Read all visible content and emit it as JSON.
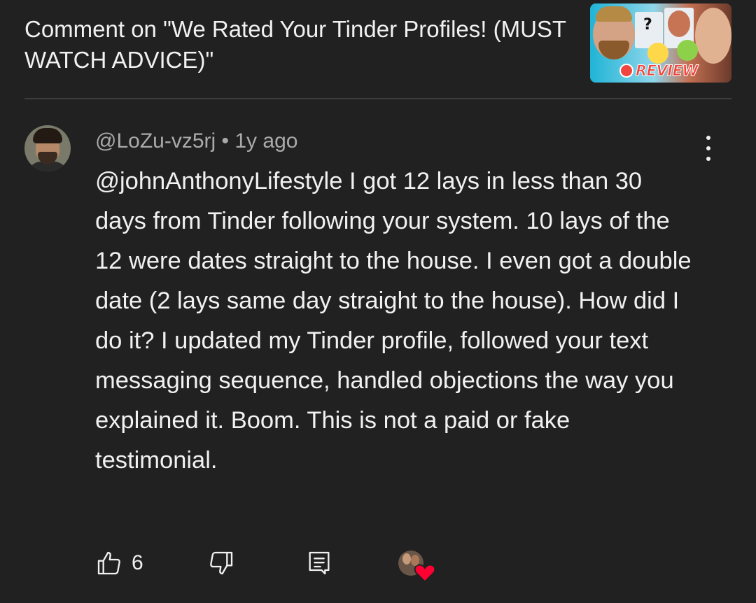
{
  "header": {
    "title": "Comment on \"We Rated Your Tinder Profiles! (MUST WATCH ADVICE)\"",
    "thumbnail_badge": "REVIEW"
  },
  "comment": {
    "author": "@LoZu-vz5rj",
    "separator": "•",
    "time": "1y ago",
    "text": "@johnAnthonyLifestyle I got 12 lays in less than 30 days from Tinder following your system. 10 lays of the 12 were dates straight to the house. I even got a double date (2 lays same day straight to the house). How did I do it? I updated my Tinder profile, followed your text messaging sequence, handled objections the way you explained it. Boom. This is not a paid or fake testimonial."
  },
  "actions": {
    "like_count": "6",
    "icons": {
      "like": "thumbs-up-icon",
      "dislike": "thumbs-down-icon",
      "reply": "reply-icon",
      "heart": "creator-heart-icon",
      "more": "more-vertical-icon"
    }
  },
  "colors": {
    "background": "#212121",
    "primary_text": "#f1f1f1",
    "secondary_text": "#aaaaaa",
    "divider": "#3d3d3d",
    "heart": "#ff0033"
  }
}
